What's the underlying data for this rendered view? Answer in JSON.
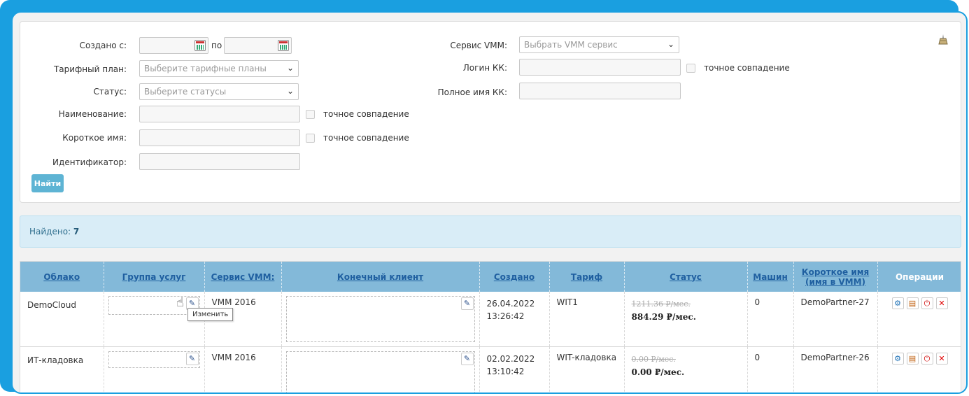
{
  "filters": {
    "created_from_label": "Создано с:",
    "created_to_label": "по",
    "tariff_label": "Тарифный план:",
    "tariff_placeholder": "Выберите тарифные планы",
    "status_label": "Статус:",
    "status_placeholder": "Выберите статусы",
    "name_label": "Наименование:",
    "exact_match": "точное совпадение",
    "short_name_label": "Короткое имя:",
    "identifier_label": "Идентификатор:",
    "vmm_label": "Сервис VMM:",
    "vmm_placeholder": "Выбрать VMM сервис",
    "login_label": "Логин КК:",
    "fullname_label": "Полное имя КК:",
    "search_button": "Найти"
  },
  "found": {
    "label": "Найдено:",
    "count": "7"
  },
  "table": {
    "headers": {
      "cloud": "Облако",
      "service_group": "Группа услуг",
      "vmm_service": "Сервис VMM:",
      "end_client": "Конечный клиент",
      "created": "Создано",
      "tariff": "Тариф",
      "status": "Статус",
      "machines": "Машин",
      "short_name_1": "Короткое имя",
      "short_name_2": "(имя в VMM)",
      "operations": "Операции"
    },
    "rows": [
      {
        "cloud": "DemoCloud",
        "vmm": "VMM 2016",
        "date": "26.04.2022",
        "time": "13:26:42",
        "tariff": "WIT1",
        "old_price": "1211.36 ₽/мес.",
        "new_price": "884.29 ₽/мес.",
        "machines": "0",
        "short_name": "DemoPartner-27"
      },
      {
        "cloud": "ИТ-кладовка",
        "vmm": "VMM 2016",
        "date": "02.02.2022",
        "time": "13:10:42",
        "tariff": "WIT-кладовка",
        "old_price": "0.00 ₽/мес.",
        "new_price": "0.00 ₽/мес.",
        "machines": "0",
        "short_name": "DemoPartner-26"
      }
    ]
  },
  "tooltip": {
    "text": "Изменить"
  },
  "icons": {
    "calendar": "calendar-icon",
    "chevron": "chevron-down-icon",
    "clear": "clear-filter-icon",
    "edit": "pencil-icon",
    "gear": "gear-icon",
    "stats": "stats-icon",
    "power": "power-icon",
    "delete": "delete-icon",
    "cursor": "hand-cursor-icon"
  }
}
